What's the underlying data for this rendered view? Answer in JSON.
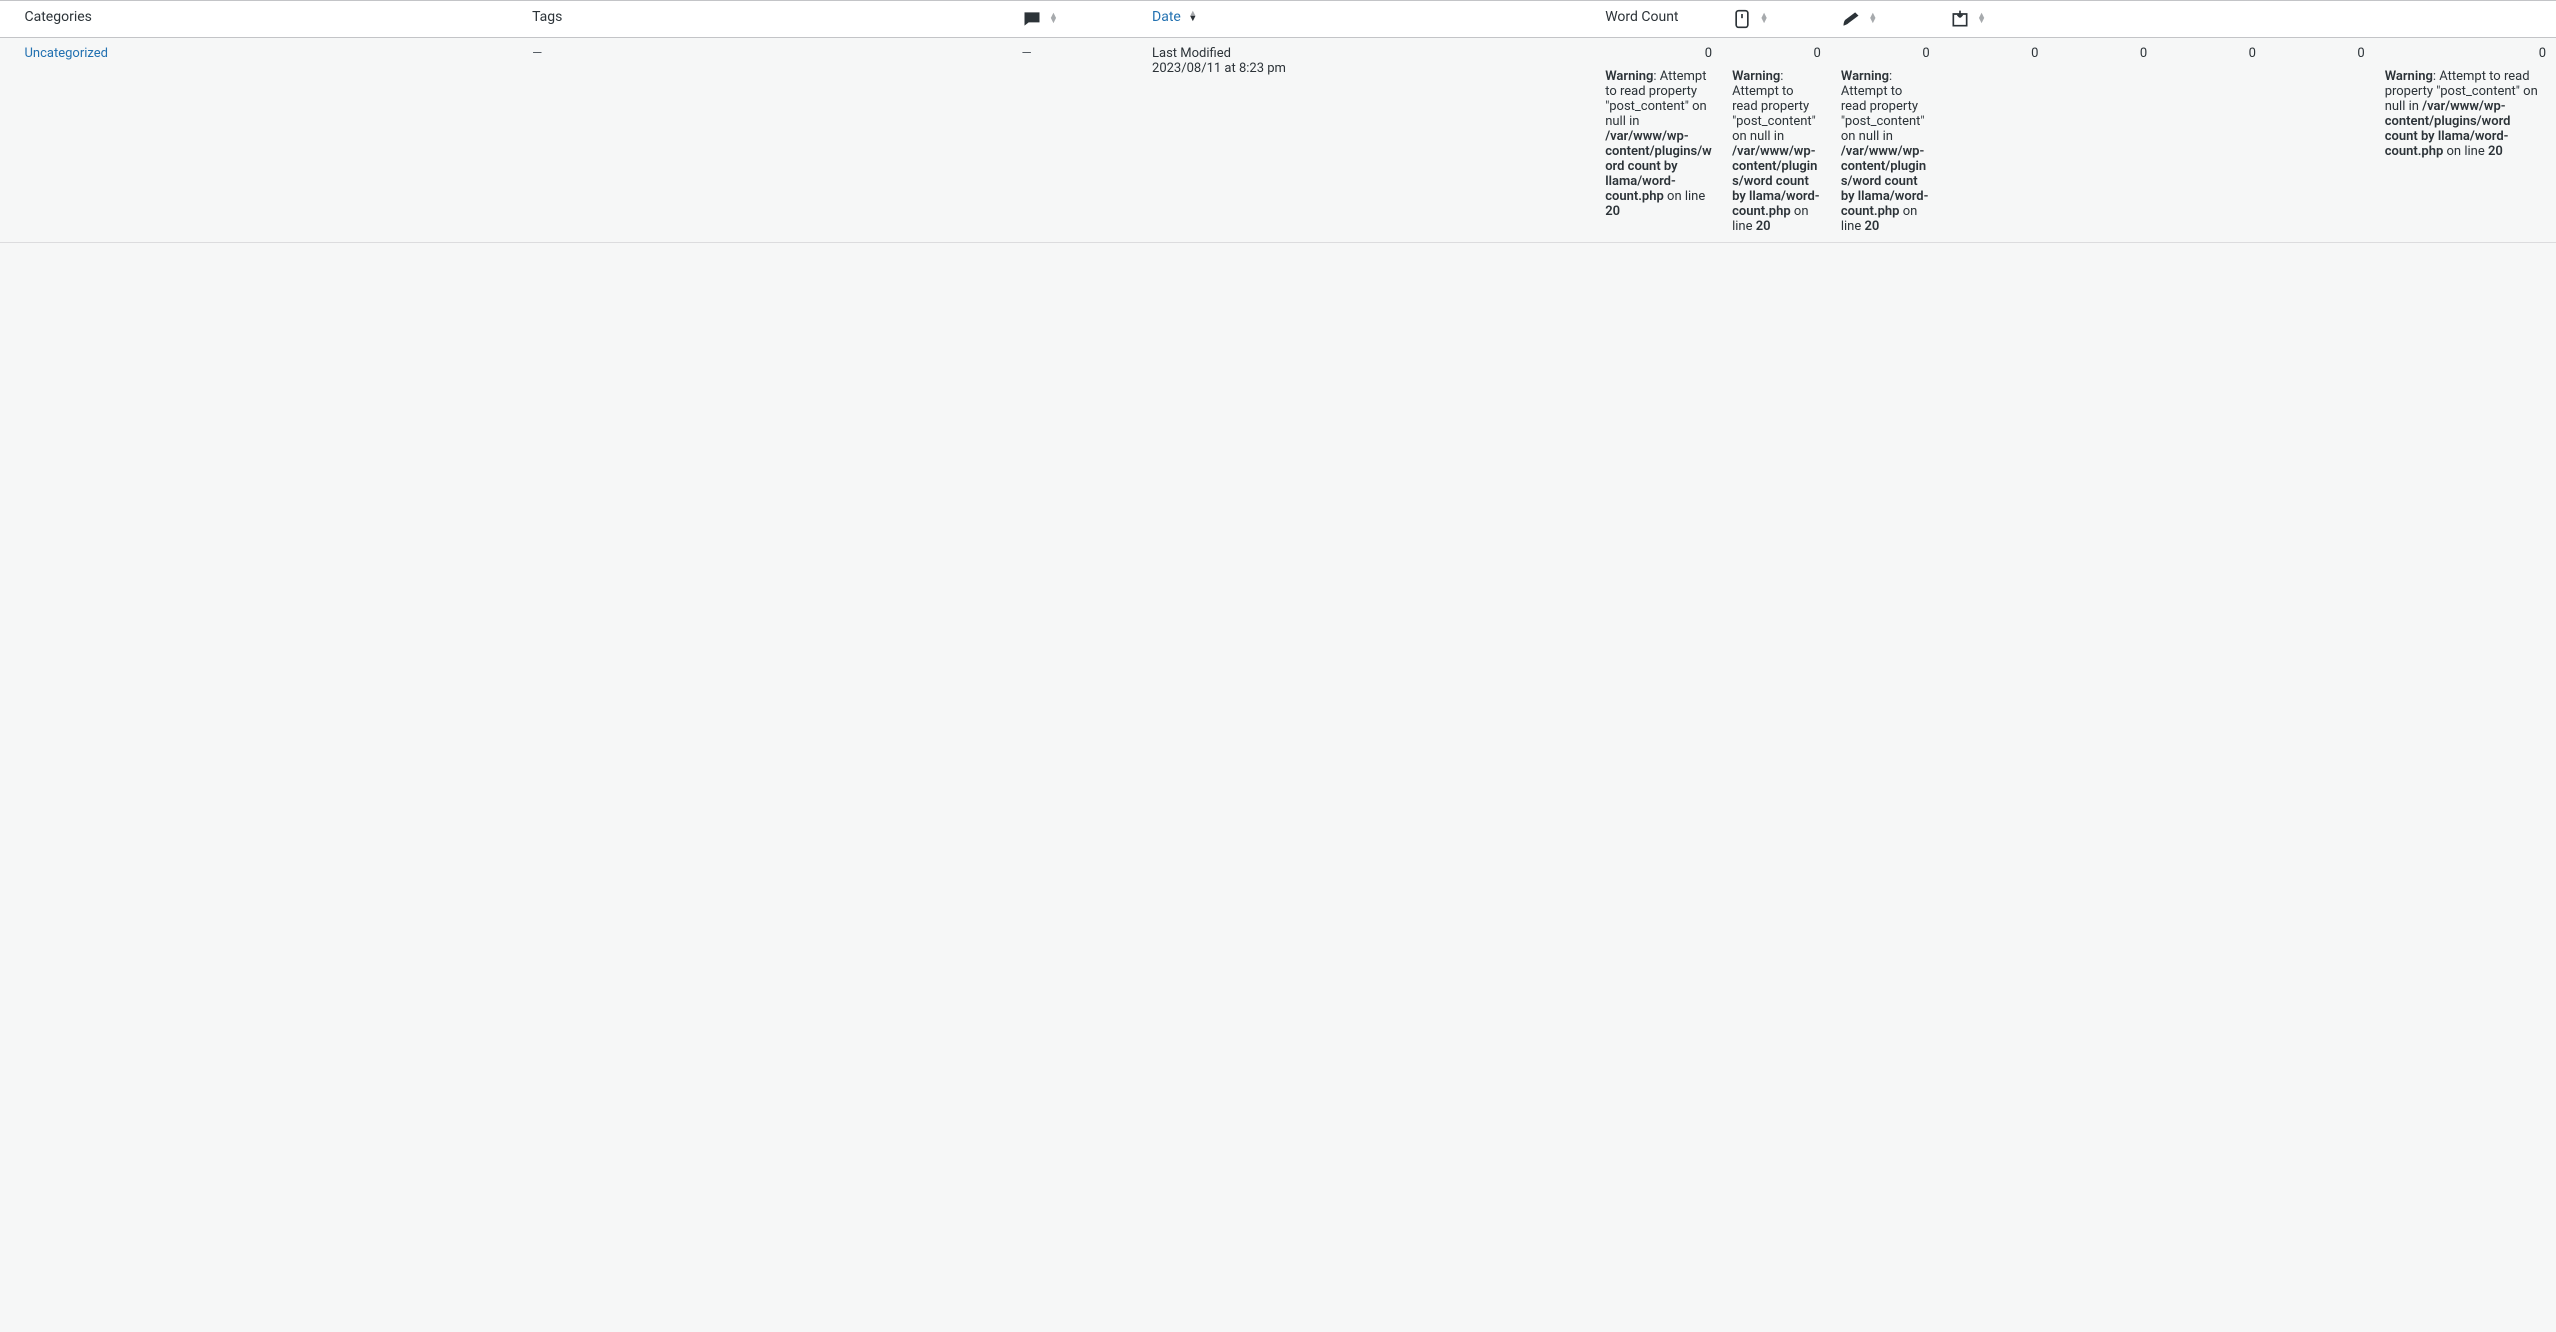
{
  "headers": {
    "categories": "Categories",
    "tags": "Tags",
    "date": "Date",
    "word_count": "Word Count"
  },
  "row": {
    "category": "Uncategorized",
    "tags_dash": "—",
    "comments_dash": "—",
    "date_label": "Last Modified",
    "date_value": "2023/08/11 at 8:23 pm",
    "zero": "0"
  },
  "warning": {
    "label": "Warning",
    "msg1": ": Attempt to read property \"post_content\" on null in ",
    "path": "/var/www/wp-content/plugins/word count by llama/word-count.php",
    "on_line": " on line ",
    "line": "20"
  }
}
